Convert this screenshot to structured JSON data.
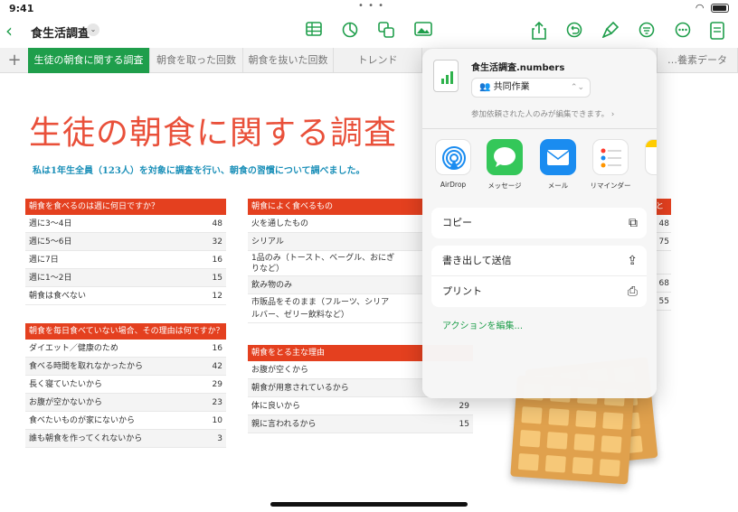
{
  "status": {
    "time": "9:41",
    "dots": "• • •"
  },
  "toolbar": {
    "title": "食生活調査",
    "back_glyph": "‹",
    "chevron": "⌄"
  },
  "tabs": [
    "生徒の朝食に関する調査",
    "朝食を取った回数",
    "朝食を抜いた回数",
    "トレンド",
    "…養素データ"
  ],
  "main": {
    "title": "生徒の朝食に関する調査",
    "subtitle": "私は1年生全員（123人）を対象に調査を行い、朝食の習慣について調べました。"
  },
  "table1": {
    "header": "朝食を食べるのは週に何日ですか？",
    "rows": [
      {
        "k": "週に3〜4日",
        "v": "48"
      },
      {
        "k": "週に5〜6日",
        "v": "32"
      },
      {
        "k": "週に7日",
        "v": "16"
      },
      {
        "k": "週に1〜2日",
        "v": "15"
      },
      {
        "k": "朝食は食べない",
        "v": "12"
      }
    ]
  },
  "table2": {
    "header": "朝食を毎日食べていない場合、その理由は何ですか？",
    "rows": [
      {
        "k": "ダイエット／健康のため",
        "v": "16"
      },
      {
        "k": "食べる時間を取れなかったから",
        "v": "42"
      },
      {
        "k": "長く寝ていたいから",
        "v": "29"
      },
      {
        "k": "お腹が空かないから",
        "v": "23"
      },
      {
        "k": "食べたいものが家にないから",
        "v": "10"
      },
      {
        "k": "誰も朝食を作ってくれないから",
        "v": "3"
      }
    ]
  },
  "table3": {
    "header": "朝食によく食べるもの",
    "rows": [
      {
        "k": "火を通したもの"
      },
      {
        "k": "シリアル"
      },
      {
        "k": "1品のみ（トースト、ベーグル、おにぎりなど）"
      },
      {
        "k": "飲み物のみ"
      },
      {
        "k": "市販品をそのまま（フルーツ、シリアルバー、ゼリー飲料など）"
      }
    ]
  },
  "table4": {
    "header": "朝食をとる主な理由",
    "rows": [
      {
        "k": "お腹が空くから",
        "v": ""
      },
      {
        "k": "朝食が用意されているから",
        "v": ""
      },
      {
        "k": "体に良いから",
        "v": "29"
      },
      {
        "k": "親に言われるから",
        "v": "15"
      }
    ]
  },
  "edge": {
    "header": "と",
    "values": [
      "48",
      "75",
      "",
      "68",
      "55"
    ]
  },
  "share": {
    "file_name": "食生活調査.numbers",
    "collab": "共同作業",
    "permission": "参加依頼された人のみが編集できます。",
    "apps": [
      {
        "label": "AirDrop",
        "color": "#ffffff"
      },
      {
        "label": "メッセージ",
        "color": "#34c759"
      },
      {
        "label": "メール",
        "color": "#1a8cf0"
      },
      {
        "label": "リマインダー",
        "color": "#ffffff"
      }
    ],
    "copy": "コピー",
    "export": "書き出して送信",
    "print": "プリント",
    "edit_actions": "アクションを編集..."
  }
}
